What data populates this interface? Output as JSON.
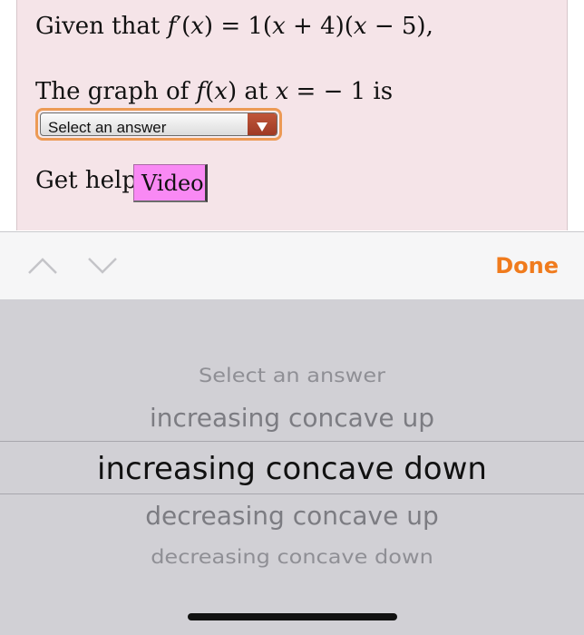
{
  "question": {
    "line1": {
      "prefix": "Given that ",
      "fn": "f",
      "prime_open": "′(",
      "var": "x",
      "eq_open": ") = 1(",
      "var2": "x",
      "mid": " + 4)(",
      "var3": "x",
      "end": " − 5),"
    },
    "line2": {
      "prefix": "The graph of ",
      "fn": "f",
      "open": "(",
      "var": "x",
      "close": ") at ",
      "var2": "x",
      "suffix": " =   − 1 is"
    },
    "select_label": "Select an answer",
    "help_label": "Get help:",
    "video_label": "Video"
  },
  "toolbar": {
    "prev_icon": "chevron-up",
    "next_icon": "chevron-down",
    "done_label": "Done",
    "accent_color": "#f07b1d"
  },
  "picker": {
    "options": [
      "Select an answer",
      "increasing concave up",
      "increasing concave down",
      "decreasing concave up",
      "decreasing concave down"
    ],
    "selected": "increasing concave down"
  }
}
